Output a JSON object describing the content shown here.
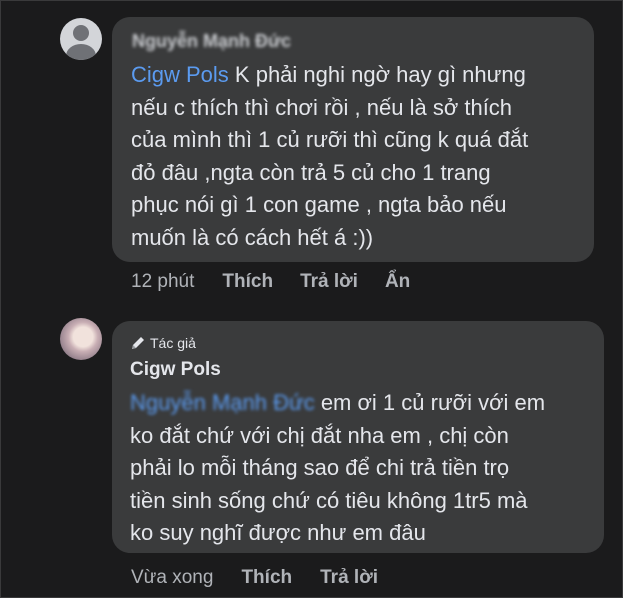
{
  "comment1": {
    "author": "Nguyễn Mạnh Đức",
    "mention": "Cigw Pols",
    "lines": [
      " K phải nghi ngờ hay gì nhưng",
      "nếu c thích thì chơi rồi , nếu là sở thích",
      "của mình thì 1 củ rưỡi thì cũng k quá đắt",
      "đỏ đâu ,ngta còn trả 5 củ cho 1 trang",
      "phục nói gì 1 con game , ngta bảo nếu",
      "muốn là có cách hết á :))"
    ],
    "time": "12 phút",
    "like": "Thích",
    "reply": "Trả lời",
    "hide": "Ẩn"
  },
  "comment2": {
    "badge": "Tác giả",
    "author": "Cigw Pols",
    "mention": "Nguyễn Mạnh Đức",
    "lines": [
      " em ơi 1 củ rưỡi với em",
      "ko đắt chứ với chị đắt nha em , chị còn",
      "phải lo mỗi tháng sao để chi trả tiền trọ",
      "tiền sinh sống chứ có tiêu không 1tr5 mà",
      "ko suy nghĩ được như em đâu"
    ],
    "time": "Vừa xong",
    "like": "Thích",
    "reply": "Trả lời"
  },
  "icons": {
    "avatar1": "default-user-icon",
    "avatar2": "profile-photo",
    "badge": "pencil-icon"
  },
  "colors": {
    "background": "#1b1b1c",
    "bubble": "#3a3b3c",
    "text": "#e4e6eb",
    "secondary": "#b0b3b8",
    "mention": "#5b9bf0"
  }
}
